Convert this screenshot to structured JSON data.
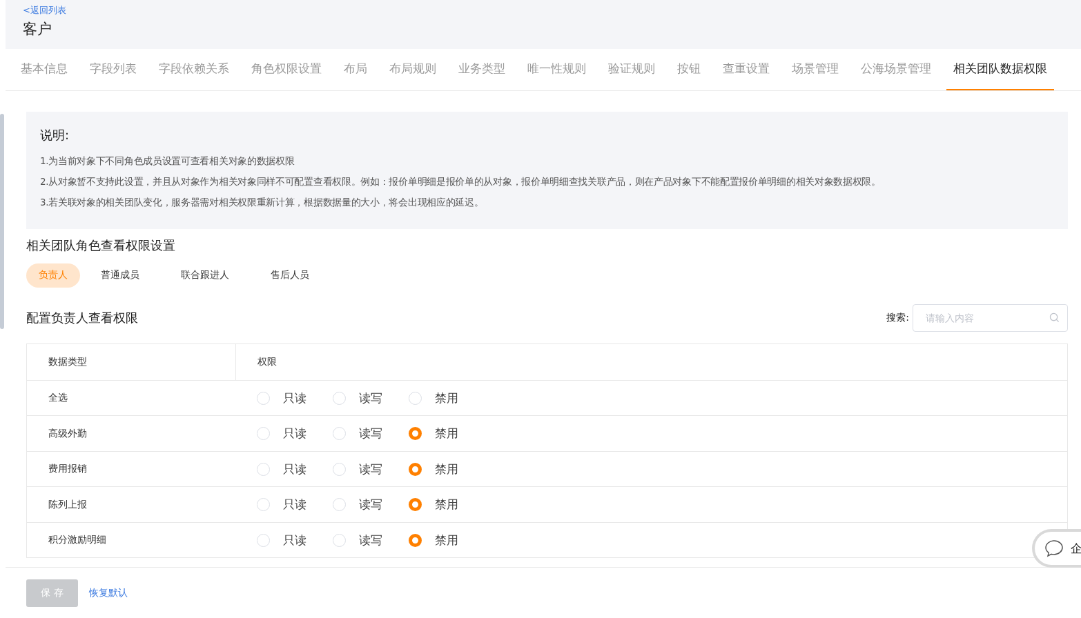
{
  "header": {
    "back_link": "<返回列表",
    "title": "客户"
  },
  "tabs": [
    {
      "label": "基本信息",
      "selected": false
    },
    {
      "label": "字段列表",
      "selected": false
    },
    {
      "label": "字段依赖关系",
      "selected": false
    },
    {
      "label": "角色权限设置",
      "selected": false
    },
    {
      "label": "布局",
      "selected": false
    },
    {
      "label": "布局规则",
      "selected": false
    },
    {
      "label": "业务类型",
      "selected": false
    },
    {
      "label": "唯一性规则",
      "selected": false
    },
    {
      "label": "验证规则",
      "selected": false
    },
    {
      "label": "按钮",
      "selected": false
    },
    {
      "label": "查重设置",
      "selected": false
    },
    {
      "label": "场景管理",
      "selected": false
    },
    {
      "label": "公海场景管理",
      "selected": false
    },
    {
      "label": "相关团队数据权限",
      "selected": true
    }
  ],
  "notice": {
    "title": "说明:",
    "lines": [
      "1.为当前对象下不同角色成员设置可查看相关对象的数据权限",
      "2.从对象暂不支持此设置，并且从对象作为相关对象同样不可配置查看权限。例如：报价单明细是报价单的从对象，报价单明细查找关联产品，则在产品对象下不能配置报价单明细的相关对象数据权限。",
      "3.若关联对象的相关团队变化，服务器需对相关权限重新计算，根据数据量的大小，将会出现相应的延迟。"
    ]
  },
  "section_title": "相关团队角色查看权限设置",
  "roles": [
    {
      "label": "负责人",
      "selected": true
    },
    {
      "label": "普通成员",
      "selected": false
    },
    {
      "label": "联合跟进人",
      "selected": false
    },
    {
      "label": "售后人员",
      "selected": false
    }
  ],
  "config_title": "配置负责人查看权限",
  "search": {
    "label": "搜索:",
    "placeholder": "请输入内容"
  },
  "table": {
    "columns": [
      "数据类型",
      "权限"
    ],
    "rows": [
      {
        "name": "全选",
        "options": [
          {
            "label": "只读",
            "selected": false
          },
          {
            "label": "读写",
            "selected": false
          },
          {
            "label": "禁用",
            "selected": false
          }
        ]
      },
      {
        "name": "高级外勤",
        "options": [
          {
            "label": "只读",
            "selected": false
          },
          {
            "label": "读写",
            "selected": false
          },
          {
            "label": "禁用",
            "selected": true
          }
        ]
      },
      {
        "name": "费用报销",
        "options": [
          {
            "label": "只读",
            "selected": false
          },
          {
            "label": "读写",
            "selected": false
          },
          {
            "label": "禁用",
            "selected": true
          }
        ]
      },
      {
        "name": "陈列上报",
        "options": [
          {
            "label": "只读",
            "selected": false
          },
          {
            "label": "读写",
            "selected": false
          },
          {
            "label": "禁用",
            "selected": true
          }
        ]
      },
      {
        "name": "积分激励明细",
        "options": [
          {
            "label": "只读",
            "selected": false
          },
          {
            "label": "读写",
            "selected": false
          },
          {
            "label": "禁用",
            "selected": true
          }
        ]
      }
    ]
  },
  "footer": {
    "save": {
      "label": "保 存",
      "disabled": true
    },
    "reset": "恢复默认"
  },
  "chat_widget": {
    "label": "企"
  }
}
